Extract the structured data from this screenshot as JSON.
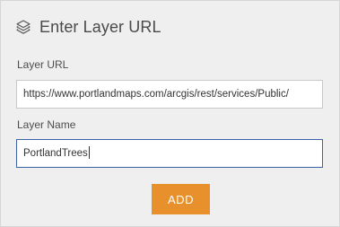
{
  "header": {
    "title": "Enter Layer URL",
    "icon": "layers-icon"
  },
  "form": {
    "url_label": "Layer URL",
    "url_value": "https://www.portlandmaps.com/arcgis/rest/services/Public/",
    "name_label": "Layer Name",
    "name_value": "PortlandTrees"
  },
  "actions": {
    "add_label": "ADD"
  },
  "colors": {
    "panel_bg": "#efefef",
    "accent_button": "#e8902c",
    "focus_border": "#3c63a8"
  }
}
